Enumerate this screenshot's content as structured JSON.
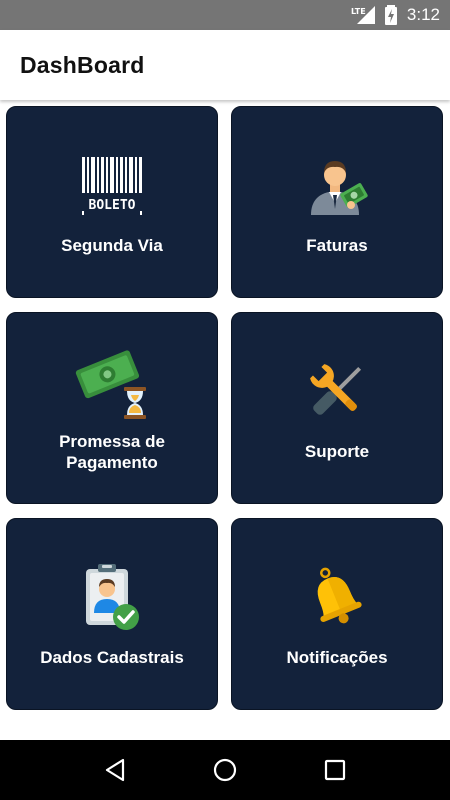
{
  "status_bar": {
    "network_label": "LTE",
    "time": "3:12"
  },
  "app_bar": {
    "title": "DashBoard"
  },
  "cards": [
    {
      "label": "Segunda Via",
      "icon": "barcode-boleto-icon",
      "icon_text": "BOLETO"
    },
    {
      "label": "Faturas",
      "icon": "businessman-money-icon"
    },
    {
      "label": "Promessa de Pagamento",
      "icon": "money-hourglass-icon"
    },
    {
      "label": "Suporte",
      "icon": "wrench-screwdriver-icon"
    },
    {
      "label": "Dados Cadastrais",
      "icon": "id-badge-check-icon"
    },
    {
      "label": "Notificações",
      "icon": "bell-icon"
    }
  ],
  "nav_bar": {
    "buttons": [
      "back",
      "home",
      "recents"
    ]
  },
  "colors": {
    "card_bg": "#13223b",
    "status_bar_bg": "#757575",
    "nav_bar_bg": "#000000"
  }
}
